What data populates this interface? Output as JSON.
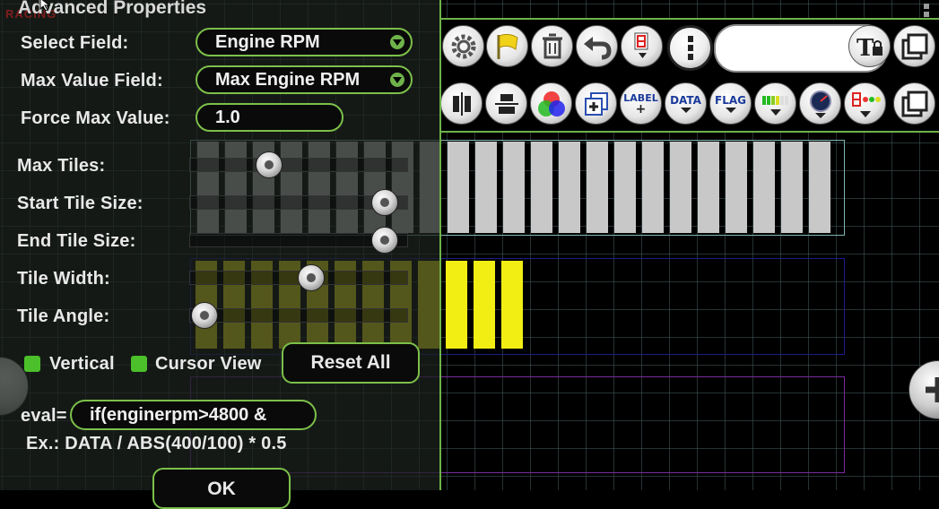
{
  "dialog": {
    "title": "Advanced Properties",
    "watermark": "RACING",
    "select_field": {
      "label": "Select Field:",
      "value": "Engine RPM"
    },
    "max_value_field": {
      "label": "Max Value Field:",
      "value": "Max Engine RPM"
    },
    "force_max_value": {
      "label": "Force Max Value:",
      "value": "1.0"
    },
    "sliders": [
      {
        "label": "Max Tiles:",
        "level": 0.36
      },
      {
        "label": "Start Tile Size:",
        "level": 0.91
      },
      {
        "label": "End Tile Size:",
        "level": 0.91
      },
      {
        "label": "Tile Width:",
        "level": 0.56
      },
      {
        "label": "Tile Angle:",
        "level": 0.05
      }
    ],
    "checkbox_vertical": {
      "label": "Vertical",
      "checked": true
    },
    "checkbox_cursor_view": {
      "label": "Cursor View",
      "checked": true
    },
    "reset_all": "Reset All",
    "eval": {
      "label": "eval=",
      "value": "if(enginerpm>4800 &"
    },
    "example": "Ex.: DATA / ABS(400/100) * 0.5",
    "ok": "OK"
  },
  "toolbar": {
    "row1": [
      {
        "name": "settings-gear-icon"
      },
      {
        "name": "flag-icon"
      },
      {
        "name": "trash-icon"
      },
      {
        "name": "undo-icon"
      },
      {
        "name": "digit-display-icon"
      },
      {
        "name": "more-vertical-icon"
      }
    ],
    "row2": [
      {
        "name": "align-horizontal-icon"
      },
      {
        "name": "align-vertical-icon"
      },
      {
        "name": "color-rgb-icon"
      },
      {
        "name": "duplicate-add-icon"
      },
      {
        "name": "label-add-icon",
        "text": "LABEL"
      },
      {
        "name": "data-dropdown-icon",
        "text": "DATA"
      },
      {
        "name": "flag-dropdown-icon",
        "text": "FLAG"
      },
      {
        "name": "bar-gauge-icon"
      },
      {
        "name": "dial-gauge-icon"
      },
      {
        "name": "led-digit-icon"
      },
      {
        "name": "copy-icon"
      }
    ]
  },
  "colors": {
    "accent": "#6fb24a",
    "tile_gray": "#c8c8c8",
    "tile_yellow": "#f2ee14"
  }
}
